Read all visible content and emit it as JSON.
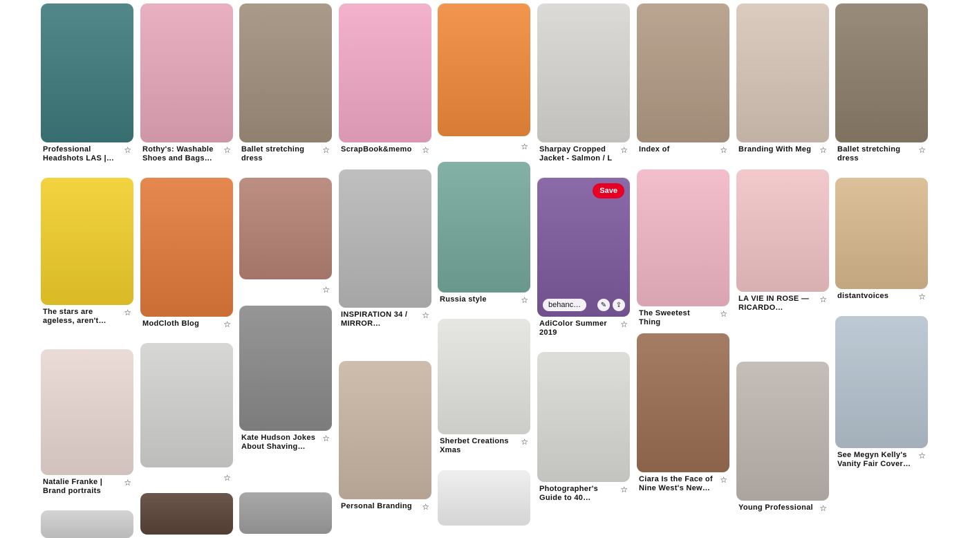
{
  "star_glyph": "☆",
  "save_label": "Save",
  "link_text": "behanc…",
  "edit_icon": "✎",
  "share_icon": "⇪",
  "pins": [
    {
      "title": "Professional Headshots LAS |…",
      "color": "#3f7a7d"
    },
    {
      "title": "Rothy's: Washable Shoes and Bags…",
      "color": "#e6a7ba"
    },
    {
      "title": "Ballet stretching dress",
      "color": "#a08f7c"
    },
    {
      "title": "ScrapBook&memo",
      "color": "#f2a9c6"
    },
    {
      "title": "",
      "color": "#f08a3b"
    },
    {
      "title": "Sharpay Cropped Jacket - Salmon / L",
      "color": "#d8d6d2"
    },
    {
      "title": "Index of",
      "color": "#b29b85"
    },
    {
      "title": "Branding With Meg",
      "color": "#d7c6b8"
    },
    {
      "title": "Ballet stretching dress",
      "color": "#8c7e6b"
    },
    {
      "title": "The stars are ageless, aren't…",
      "color": "#f1cf2a"
    },
    {
      "title": "ModCloth Blog",
      "color": "#e27a3c"
    },
    {
      "title": "",
      "color": "#b58275"
    },
    {
      "title": "INSPIRATION 34 / MIRROR…",
      "color": "#b8b8b8"
    },
    {
      "title": "Russia style",
      "color": "#76a89c"
    },
    {
      "title": "AdiColor Summer 2019",
      "color": "#7d5a9e"
    },
    {
      "title": "The Sweetest Thing",
      "color": "#f2b7c6"
    },
    {
      "title": "LA VIE IN ROSE — RICARDO…",
      "color": "#f1c3c6"
    },
    {
      "title": "distantvoices",
      "color": "#d7b98e"
    },
    {
      "title": "Natalie Franke | Brand portraits",
      "color": "#e9d7d2"
    },
    {
      "title": "",
      "color": "#d2d2d0"
    },
    {
      "title": "Kate Hudson Jokes About Shaving He…",
      "color": "#8a8a8a"
    },
    {
      "title": "Personal Branding",
      "color": "#c9b6a3"
    },
    {
      "title": "Sherbet Creations Xmas",
      "color": "#e3e3df"
    },
    {
      "title": "Photographer's Guide to 40…",
      "color": "#d9d9d5"
    },
    {
      "title": "Ciara Is the Face of Nine West's New…",
      "color": "#9a6e52"
    },
    {
      "title": "Young Professional",
      "color": "#bfb7b0"
    },
    {
      "title": "See Megyn Kelly's Vanity Fair Cover…",
      "color": "#b6c3cf"
    },
    {
      "title": "",
      "color": "#cfcfcf"
    },
    {
      "title": "",
      "color": "#5a4438"
    },
    {
      "title": "",
      "color": "#9e9e9e"
    },
    {
      "title": "",
      "color": "#ededed"
    }
  ]
}
